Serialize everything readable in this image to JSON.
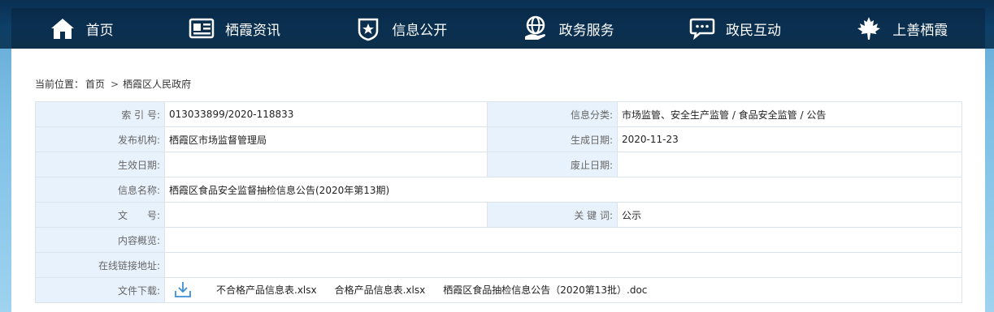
{
  "nav": {
    "items": [
      {
        "label": "首页",
        "icon": "home-icon"
      },
      {
        "label": "栖霞资讯",
        "icon": "news-icon"
      },
      {
        "label": "信息公开",
        "icon": "shield-star-icon"
      },
      {
        "label": "政务服务",
        "icon": "globe-hand-icon"
      },
      {
        "label": "政民互动",
        "icon": "chat-bubble-icon"
      },
      {
        "label": "上善栖霞",
        "icon": "maple-leaf-icon"
      }
    ]
  },
  "breadcrumb": {
    "prefix": "当前位置：",
    "home": "首页",
    "separator": ">",
    "current": "栖霞区人民政府"
  },
  "info": {
    "index_label": "索 引 号:",
    "index_value": "013033899/2020-118833",
    "category_label": "信息分类:",
    "category_value": "市场监管、安全生产监管 / 食品安全监管 / 公告",
    "publisher_label": "发布机构:",
    "publisher_value": "栖霞区市场监督管理局",
    "created_label": "生成日期:",
    "created_value": "2020-11-23",
    "effective_label": "生效日期:",
    "effective_value": "",
    "expire_label": "废止日期:",
    "expire_value": "",
    "name_label": "信息名称:",
    "name_value": "栖霞区食品安全监督抽检信息公告(2020年第13期)",
    "docno_label": "文　　号:",
    "docno_value": "",
    "keywords_label": "关 键 词:",
    "keywords_value": "公示",
    "summary_label": "内容概览:",
    "summary_value": "",
    "link_label": "在线链接地址:",
    "link_value": "",
    "files_label": "文件下载:",
    "files": [
      "不合格产品信息表.xlsx",
      "合格产品信息表.xlsx",
      "栖霞区食品抽检信息公告（2020第13批）.doc"
    ]
  },
  "colors": {
    "nav_bg": "#0d3f68",
    "label_bg": "#e8f2fc",
    "border": "#dde3ea"
  }
}
